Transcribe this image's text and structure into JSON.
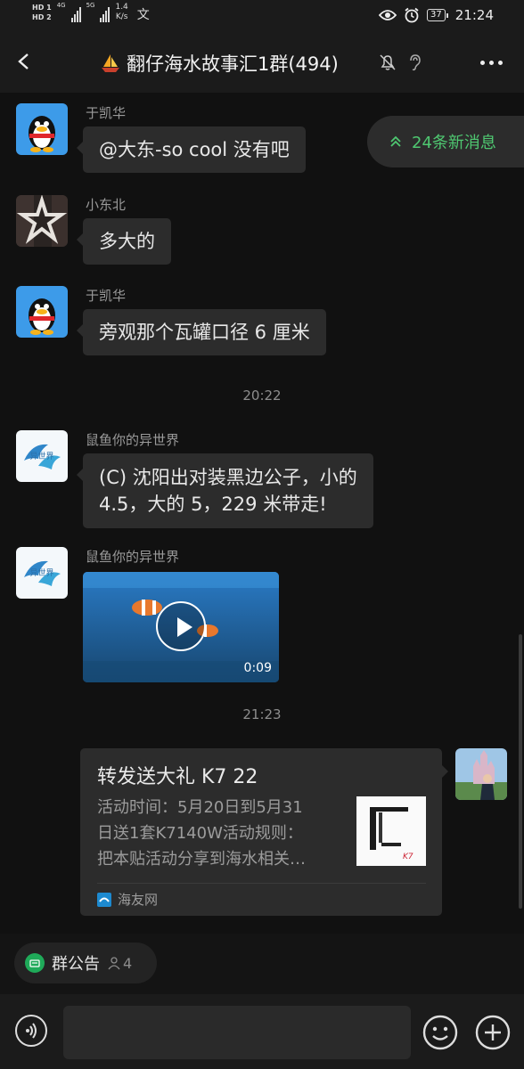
{
  "status_bar": {
    "hd1": "HD 1",
    "hd2": "HD 2",
    "net1": "4G",
    "net2": "5G",
    "speed_value": "1.4",
    "speed_unit": "K/s",
    "misc_icon": "文",
    "battery": "37",
    "time": "21:24",
    "icons": [
      "eye-icon",
      "alarm-icon",
      "battery-icon"
    ]
  },
  "header": {
    "title": "翻仔海水故事汇1群(494)",
    "title_prefix_icon": "sailboat-icon",
    "icons": [
      "back-icon",
      "bell-off-icon",
      "ear-icon",
      "more-icon"
    ]
  },
  "new_messages": {
    "label": "24条新消息",
    "color": "#4fc871"
  },
  "timestamps": [
    "20:22",
    "21:23"
  ],
  "messages": [
    {
      "sender": "于凯华",
      "text": "@大东-so cool   没有吧",
      "avatar": "qq-penguin-avatar"
    },
    {
      "sender": "小东北",
      "text": "多大的",
      "avatar": "star-hands-avatar"
    },
    {
      "sender": "于凯华",
      "text": "旁观那个瓦罐口径 6 厘米",
      "avatar": "qq-penguin-avatar"
    },
    {
      "sender": "鼠鱼你的异世界",
      "text_line1": "(C) 沈阳出对装黑边公子，小的",
      "text_line2": "4.5，大的 5，229 米带走!",
      "avatar": "fish-logo-avatar"
    },
    {
      "sender": "鼠鱼你的异世界",
      "video_duration": "0:09",
      "avatar": "fish-logo-avatar"
    }
  ],
  "link_card": {
    "title": "转发送大礼 K7 22",
    "desc_line1": "活动时间：5月20日到5月31",
    "desc_line2": "日送1套K7140W活动规则：",
    "desc_line3": "把本贴活动分享到海水相关…",
    "source": "海友网",
    "thumb_brand": "K7"
  },
  "announcement": {
    "label": "群公告",
    "count": "4"
  },
  "colors": {
    "background": "#111111",
    "bubble": "#2c2c2c",
    "accent": "#4fc871",
    "bar": "#1b1b1b"
  }
}
